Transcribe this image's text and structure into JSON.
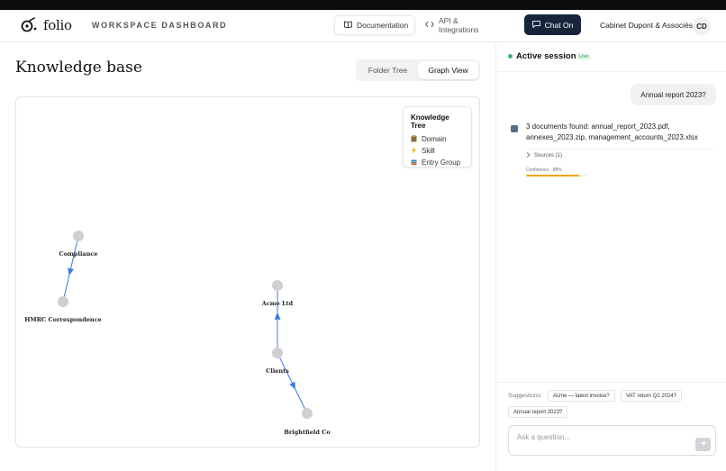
{
  "header": {
    "logo_text": "folio",
    "workspace_label": "WORKSPACE DASHBOARD",
    "documentation_label": "Documentation",
    "api_label": "API & Integrations",
    "chat_label": "Chat On",
    "firm_name": "Cabinet Dupont & Associés",
    "avatar_initials": "CD"
  },
  "main": {
    "title": "Knowledge base",
    "view_toggle": {
      "options": [
        "Folder Tree",
        "Graph View"
      ],
      "active": "Graph View"
    }
  },
  "legend": {
    "title": "Knowledge Tree",
    "items": [
      {
        "icon": "domain-icon",
        "label": "Domain"
      },
      {
        "icon": "skill-icon",
        "label": "Skill"
      },
      {
        "icon": "entry-group-icon",
        "label": "Entry Group"
      }
    ]
  },
  "graph": {
    "nodes": [
      {
        "id": "compliance",
        "label": "Compliance"
      },
      {
        "id": "hmrc",
        "label": "HMRC Correspondence"
      },
      {
        "id": "acme",
        "label": "Acme Ltd"
      },
      {
        "id": "clients",
        "label": "Clients"
      },
      {
        "id": "brightfield",
        "label": "Brightfield Co"
      }
    ],
    "edges": [
      {
        "from": "compliance",
        "to": "hmrc"
      },
      {
        "from": "clients",
        "to": "acme"
      },
      {
        "from": "clients",
        "to": "brightfield"
      }
    ],
    "edge_color": "#3b7be0",
    "node_color": "#cfcfcf"
  },
  "chat": {
    "session_title": "Active session",
    "live_badge": "Live",
    "user_message": "Annual report 2023?",
    "bot_message": "3 documents found: annual_report_2023.pdf, annexes_2023.zip, management_accounts_2023.xlsx",
    "sources_label": "Sources (1)",
    "confidence_label": "Confidence · 88%",
    "confidence_value": 0.88,
    "suggestions_label": "Suggestions:",
    "suggestions": [
      "Acme — latest invoice?",
      "VAT return Q2 2024?",
      "Annual report 2023?"
    ],
    "input_placeholder": "Ask a question..."
  }
}
